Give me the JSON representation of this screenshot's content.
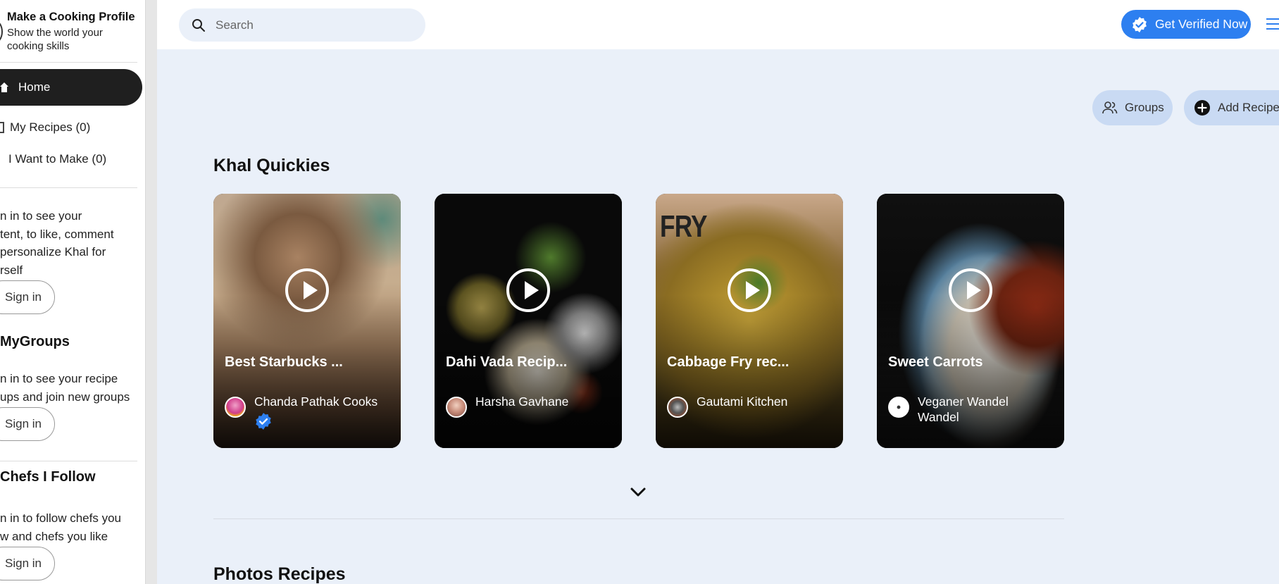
{
  "sidebar": {
    "profile_title": "Make a Cooking Profile",
    "profile_subtitle": "Show the world your cooking skills",
    "home_label": "Home",
    "my_recipes_label": "My Recipes (0)",
    "want_to_make_label": "I Want to Make (0)",
    "signin_prompt_1": [
      "n in to see your",
      "tent, to like, comment",
      " personalize Khal for",
      "rself"
    ],
    "signin_label": "Sign in",
    "groups_heading": "MyGroups",
    "signin_prompt_2": [
      "n in to see your recipe",
      "ups and join new groups"
    ],
    "chefs_heading": "Chefs I Follow",
    "signin_prompt_3": [
      "n in to follow chefs you",
      "w and chefs you like"
    ]
  },
  "topbar": {
    "search_placeholder": "Search",
    "verified_label": "Get Verified Now"
  },
  "actions": {
    "groups_label": "Groups",
    "add_recipe_label": "Add Recipe"
  },
  "sections": {
    "quickies_title": "Khal Quickies",
    "photos_title": "Photos Recipes"
  },
  "cards": [
    {
      "title": "Best Starbucks ...",
      "author": "Chanda Pathak Cooks",
      "verified": true
    },
    {
      "title": "Dahi Vada Recip...",
      "author": "Harsha Gavhane",
      "verified": false
    },
    {
      "title": "Cabbage Fry rec...",
      "author": "Gautami Kitchen",
      "verified": false,
      "overlay_text": "FRY"
    },
    {
      "title": "Sweet Carrots",
      "author": "Veganer Wandel Wandel",
      "verified": false
    }
  ],
  "colors": {
    "accent": "#2d7ff0",
    "pill": "#c9daf3",
    "page_bg": "#eaf0f9"
  },
  "icons": [
    "search-icon",
    "verified-badge-icon",
    "menu-icon",
    "home-icon",
    "groups-icon",
    "plus-circle-icon",
    "play-icon",
    "chevron-down-icon"
  ]
}
